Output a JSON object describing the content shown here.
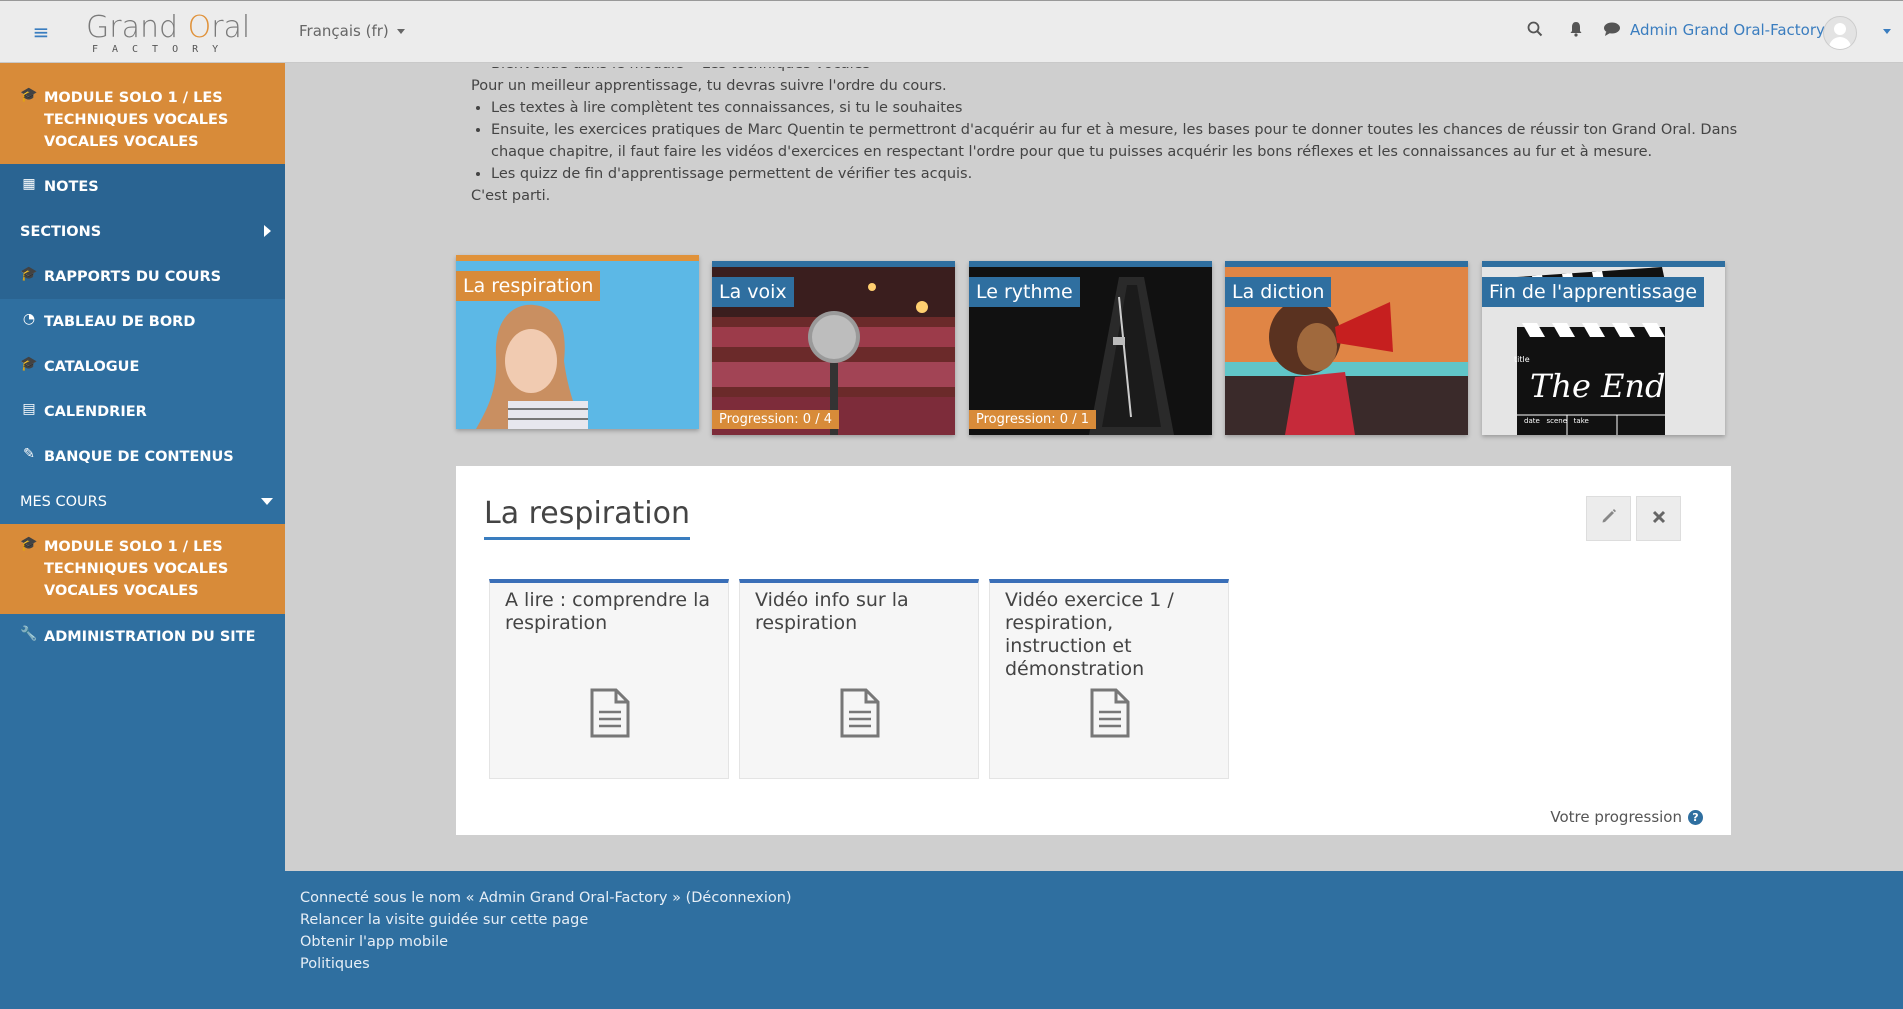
{
  "navbar": {
    "logo": {
      "word1": "Grand ",
      "word2_o": "O",
      "word2_rest": "ral",
      "sub": "FACTORY"
    },
    "language": "Français (fr)",
    "username": "Admin Grand Oral-Factory"
  },
  "sidebar": {
    "current_course": "MODULE SOLO 1 / LES TECHNIQUES VOCALES VOCALES VOCALES",
    "notes": "NOTES",
    "sections": "SECTIONS",
    "rapports": "RAPPORTS DU COURS",
    "tableau": "TABLEAU DE BORD",
    "catalogue": "CATALOGUE",
    "calendrier": "CALENDRIER",
    "banque": "BANQUE DE CONTENUS",
    "mes_cours": "MES COURS",
    "course_item": "MODULE SOLO 1 / LES TECHNIQUES VOCALES VOCALES VOCALES",
    "admin": "ADMINISTRATION DU SITE"
  },
  "intro": {
    "clipped": "Bienvenue dans le module « Les techniques vocales »",
    "line1": "Pour un meilleur apprentissage, tu devras suivre l'ordre du cours.",
    "bullet1": "Les textes à lire complètent tes connaissances, si tu le souhaites",
    "bullet2": "Ensuite, les exercices pratiques de Marc Quentin te permettront d'acquérir au fur et à mesure, les bases pour te donner toutes les chances de réussir ton Grand Oral. Dans chaque chapitre, il faut faire les vidéos d'exercices en respectant l'ordre pour que tu puisses acquérir les bons réflexes et les connaissances au fur et à mesure.",
    "bullet3": "Les quizz de fin d'apprentissage permettent de vérifier tes acquis.",
    "closing": "C'est parti."
  },
  "tiles": [
    {
      "title": "La respiration",
      "progress": "",
      "active": true
    },
    {
      "title": "La voix",
      "progress": "Progression: 0 / 4",
      "active": false
    },
    {
      "title": "Le rythme",
      "progress": "Progression: 0 / 1",
      "active": false
    },
    {
      "title": "La diction",
      "progress": "",
      "active": false
    },
    {
      "title": "Fin de l'apprentissage",
      "progress": "",
      "active": false
    }
  ],
  "end_clapper": {
    "top_labels": "title",
    "text": "The End",
    "labels": "date   scene   take"
  },
  "panel": {
    "title": "La respiration",
    "activities": [
      {
        "title": "A lire : comprendre la respiration"
      },
      {
        "title": "Vidéo info sur la respiration"
      },
      {
        "title": "Vidéo exercice 1 / respiration, instruction et démonstration"
      }
    ],
    "progress_label": "Votre progression",
    "help": "?"
  },
  "footer": {
    "connected_prefix": "Connecté sous le nom « ",
    "connected_user": "Admin Grand Oral-Factory",
    "connected_suffix": " » (",
    "logout": "Déconnexion",
    "close_paren": ")",
    "restart_tour": "Relancer la visite guidée sur cette page",
    "mobile_app": "Obtenir l'app mobile",
    "policies": "Politiques"
  },
  "colors": {
    "blue": "#2f6fa0",
    "orange": "#d88b39",
    "link": "#3a7dbf"
  }
}
